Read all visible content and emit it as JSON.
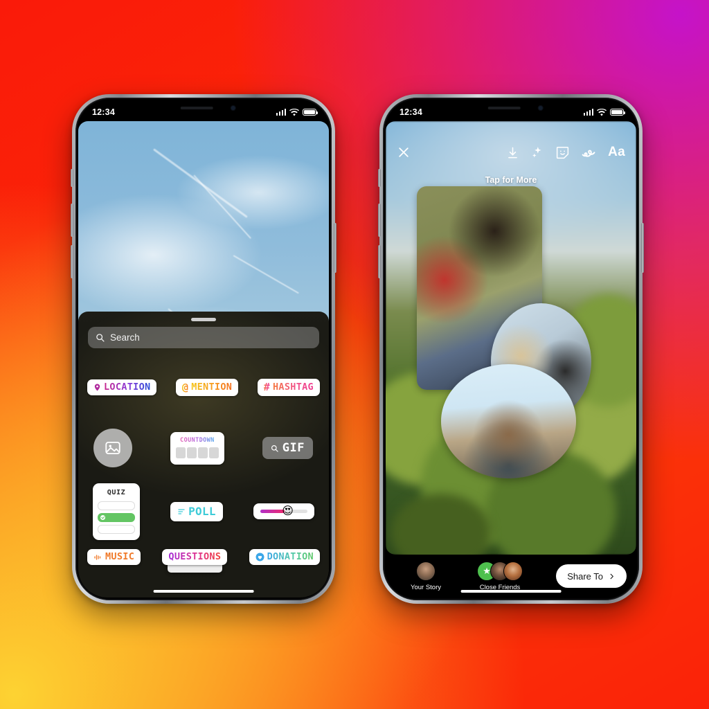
{
  "background": {
    "gradient_colors": [
      "#fa1a09",
      "#fb3c08",
      "#fdd332",
      "#c513c9"
    ]
  },
  "left_phone": {
    "status_bar": {
      "time": "12:34",
      "signal_icon": "cellular-bars-icon",
      "wifi_icon": "wifi-icon",
      "battery_icon": "battery-icon"
    },
    "tray": {
      "grabber": "drag-handle",
      "search": {
        "placeholder": "Search",
        "icon": "search-icon"
      },
      "rows": [
        [
          {
            "id": "location",
            "label": "LOCATION",
            "icon": "location-pin-icon",
            "style": "g-loc"
          },
          {
            "id": "mention",
            "label": "MENTION",
            "icon": "at-sign-icon",
            "style": "g-men"
          },
          {
            "id": "hashtag",
            "label": "HASHTAG",
            "icon": "hash-icon",
            "style": "g-hash"
          }
        ],
        [
          {
            "id": "photo",
            "label": "",
            "icon": "photo-icon"
          },
          {
            "id": "countdown",
            "label": "COUNTDOWN",
            "icon": "countdown-icon"
          },
          {
            "id": "gif",
            "label": "GIF",
            "icon": "search-icon"
          }
        ],
        [
          {
            "id": "quiz",
            "label": "QUIZ",
            "icon": "quiz-icon"
          },
          {
            "id": "poll",
            "label": "POLL",
            "icon": "poll-bars-icon",
            "style": "c-poll"
          },
          {
            "id": "slider",
            "label": "",
            "icon": "emoji-slider-icon",
            "emoji": "😍"
          }
        ],
        [
          {
            "id": "music",
            "label": "MUSIC",
            "icon": "music-wave-icon",
            "style": "c-music"
          },
          {
            "id": "questions",
            "label": "QUESTIONS",
            "icon": "questions-icon",
            "style": "g-quest"
          },
          {
            "id": "donation",
            "label": "DONATION",
            "icon": "heart-circle-icon",
            "style": "g-don"
          }
        ]
      ]
    }
  },
  "right_phone": {
    "status_bar": {
      "time": "12:34",
      "signal_icon": "cellular-bars-icon",
      "wifi_icon": "wifi-icon",
      "battery_icon": "battery-icon"
    },
    "toolbar": {
      "close": "close-icon",
      "save": "download-icon",
      "effects": "sparkles-icon",
      "sticker": "sticker-smiley-icon",
      "draw": "draw-squiggle-icon",
      "text": "Aa"
    },
    "tap_for_more": "Tap for More",
    "share_bar": {
      "your_story": {
        "label": "Your Story",
        "icon": "avatar"
      },
      "close_friends": {
        "label": "Close Friends",
        "icon": "close-friends-star-icon"
      },
      "share_button": {
        "label": "Share To",
        "icon": "chevron-right-icon"
      }
    }
  }
}
